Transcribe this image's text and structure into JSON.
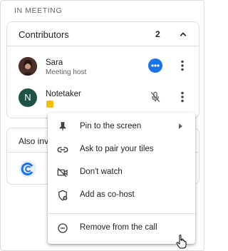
{
  "section": {
    "label": "IN MEETING"
  },
  "contributors": {
    "title": "Contributors",
    "count": "2",
    "people": [
      {
        "name": "Sara",
        "subtitle": "Meeting host"
      },
      {
        "name": "Notetaker",
        "avatar_letter": "N"
      }
    ]
  },
  "also_invited": {
    "title": "Also invi"
  },
  "menu": {
    "items": [
      {
        "label": "Pin to the screen",
        "icon": "pin-icon"
      },
      {
        "label": "Ask to pair your tiles",
        "icon": "link-icon"
      },
      {
        "label": "Don't watch",
        "icon": "videocam-off-icon"
      },
      {
        "label": "Add as co-host",
        "icon": "shield-add-icon"
      },
      {
        "label": "Remove from the call",
        "icon": "remove-circle-icon"
      }
    ]
  },
  "colors": {
    "accent": "#1a73e8",
    "notetaker_avatar": "#1e5245",
    "note_badge": "#fbbc04"
  }
}
